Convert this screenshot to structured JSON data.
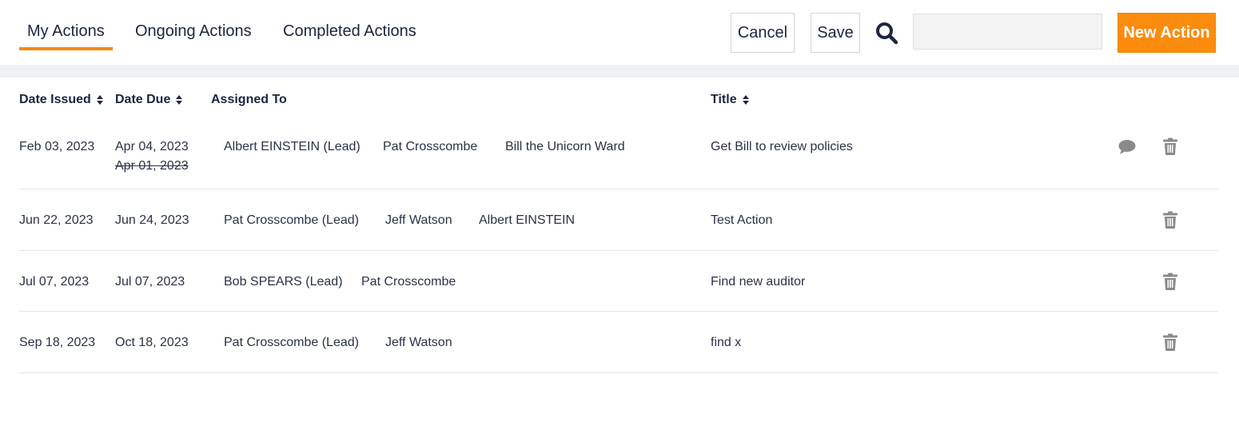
{
  "tabs": [
    {
      "label": "My Actions",
      "active": true
    },
    {
      "label": "Ongoing Actions",
      "active": false
    },
    {
      "label": "Completed Actions",
      "active": false
    }
  ],
  "toolbar": {
    "cancel_label": "Cancel",
    "save_label": "Save",
    "search_placeholder": "",
    "search_value": "",
    "new_action_label": "New Action"
  },
  "colors": {
    "accent": "#fb8c0e",
    "text": "#1c2541",
    "icon_gray": "#8a8a8a",
    "band": "#eff1f5"
  },
  "icons": {
    "search": "search-icon",
    "sort": "sort-icon",
    "comment": "comment-icon",
    "delete": "trash-icon"
  },
  "table": {
    "headers": {
      "date_issued": "Date Issued",
      "date_due": "Date Due",
      "assigned_to": "Assigned To",
      "title": "Title"
    },
    "rows": [
      {
        "date_issued": "Feb 03, 2023",
        "date_due": "Apr 04, 2023",
        "date_due_previous": "Apr 01, 2023",
        "assignees": [
          "Albert EINSTEIN (Lead)",
          "Pat Crosscombe",
          "Bill the Unicorn Ward"
        ],
        "title": "Get Bill to review policies",
        "has_comment": true
      },
      {
        "date_issued": "Jun 22, 2023",
        "date_due": "Jun 24, 2023",
        "assignees": [
          "Pat Crosscombe (Lead)",
          "Jeff Watson",
          "Albert EINSTEIN"
        ],
        "title": "Test Action",
        "has_comment": false
      },
      {
        "date_issued": "Jul 07, 2023",
        "date_due": "Jul 07, 2023",
        "assignees": [
          "Bob SPEARS (Lead)",
          "Pat Crosscombe"
        ],
        "title": "Find new auditor",
        "has_comment": false
      },
      {
        "date_issued": "Sep 18, 2023",
        "date_due": "Oct 18, 2023",
        "assignees": [
          "Pat Crosscombe (Lead)",
          "Jeff Watson"
        ],
        "title": "find x",
        "has_comment": false
      }
    ]
  }
}
